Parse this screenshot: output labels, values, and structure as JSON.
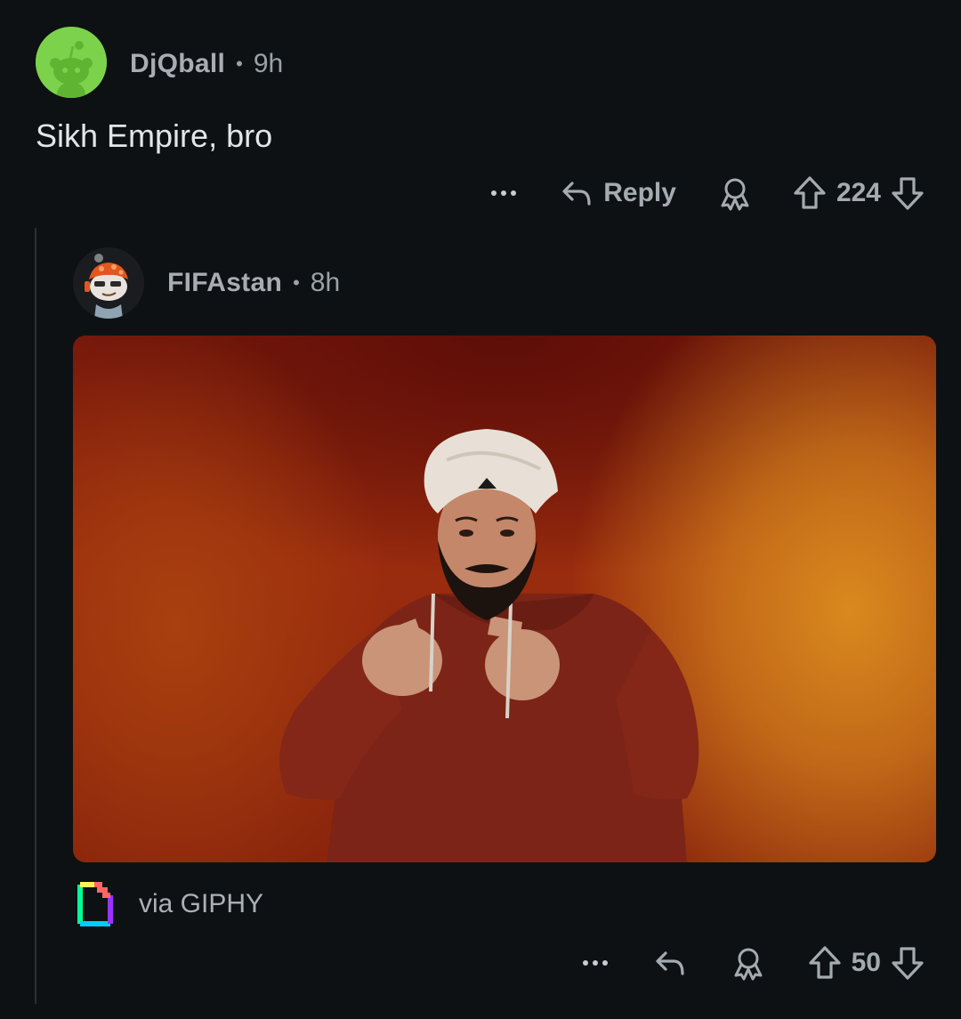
{
  "comment": {
    "username": "DjQball",
    "separator": "•",
    "age": "9h",
    "body": "Sikh Empire, bro",
    "reply_label": "Reply",
    "score": "224"
  },
  "reply": {
    "username": "FIFAstan",
    "separator": "•",
    "age": "8h",
    "attribution": "via GIPHY",
    "score": "50"
  },
  "colors": {
    "background": "#0e1113",
    "avatar_green": "#7cd34b",
    "muted_text": "#a4abb0"
  },
  "icons": [
    "reddit-snoo-avatar-icon",
    "more-options-icon",
    "reply-arrow-icon",
    "award-icon",
    "upvote-arrow-icon",
    "downvote-arrow-icon",
    "giphy-logo-icon"
  ]
}
